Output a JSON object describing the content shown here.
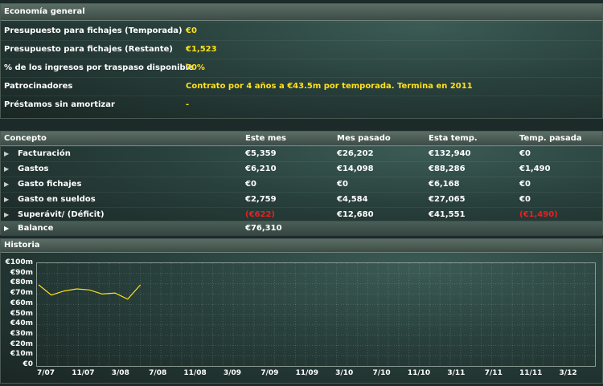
{
  "economy": {
    "title": "Economía general",
    "rows": [
      {
        "label": "Presupuesto para fichajes (Temporada)",
        "value": "€0"
      },
      {
        "label": "Presupuesto para fichajes (Restante)",
        "value": "€1,523"
      },
      {
        "label": "% de los ingresos por traspaso disponible",
        "value": "70%"
      },
      {
        "label": "Patrocinadores",
        "value": "Contrato por 4 años a €43.5m por temporada. Termina en 2011"
      },
      {
        "label": "Préstamos sin amortizar",
        "value": "-"
      }
    ]
  },
  "table": {
    "headers": [
      "Concepto",
      "Este mes",
      "Mes pasado",
      "Esta temp.",
      "Temp. pasada"
    ],
    "rows": [
      {
        "label": "Facturación",
        "values": [
          "€5,359",
          "€26,202",
          "€132,940",
          "€0"
        ]
      },
      {
        "label": "Gastos",
        "values": [
          "€6,210",
          "€14,098",
          "€88,286",
          "€1,490"
        ]
      },
      {
        "label": "Gasto fichajes",
        "values": [
          "€0",
          "€0",
          "€6,168",
          "€0"
        ]
      },
      {
        "label": "Gasto en sueldos",
        "values": [
          "€2,759",
          "€4,584",
          "€27,065",
          "€0"
        ]
      },
      {
        "label": "Superávit/ (Déficit)",
        "values": [
          "(€622)",
          "€12,680",
          "€41,551",
          "(€1,490)"
        ]
      }
    ],
    "balance": {
      "label": "Balance",
      "value": "€76,310"
    },
    "negative_color": "#e52222"
  },
  "history": {
    "title": "Historia",
    "y_labels": [
      "€100m",
      "€90m",
      "€80m",
      "€70m",
      "€60m",
      "€50m",
      "€40m",
      "€30m",
      "€20m",
      "€10m",
      "€0"
    ],
    "x_labels": [
      "7/07",
      "11/07",
      "3/08",
      "7/08",
      "11/08",
      "3/09",
      "7/09",
      "11/09",
      "3/10",
      "7/10",
      "11/10",
      "3/11",
      "7/11",
      "11/11",
      "3/12"
    ],
    "line_color": "#ffe21a",
    "series": [
      79,
      69,
      73,
      75,
      74,
      70,
      71,
      65,
      79
    ]
  },
  "accent": "#ffe21a"
}
